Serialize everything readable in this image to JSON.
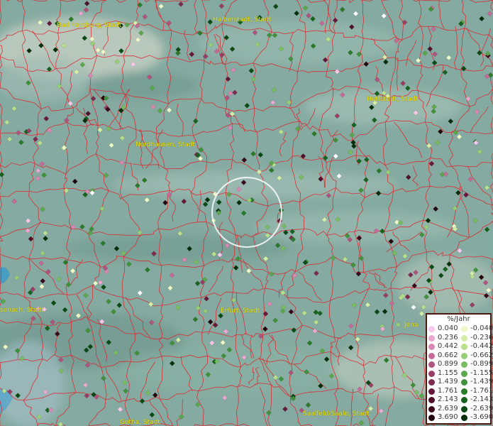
{
  "places": [
    {
      "name": "Bad Harzburg, Stadt"
    },
    {
      "name": "Halberstadt, Stadt"
    },
    {
      "name": "Hettstedt, Stadt"
    },
    {
      "name": "Nordhausen, Stadt"
    },
    {
      "name": "senach, Stadt"
    },
    {
      "name": "Erfurt, Stadt"
    },
    {
      "name": "Jena"
    },
    {
      "name": "Saalfeld/Saale, Stadt"
    },
    {
      "name": "Gotha, Stadt"
    }
  ],
  "legend": {
    "title": "%/Jahr",
    "positive": [
      "0.040",
      "0.236",
      "0.442",
      "0.662",
      "0.899",
      "1.155",
      "1.439",
      "1.761",
      "2.143",
      "2.639",
      "3.690"
    ],
    "negative": [
      "-0.040",
      "-0.236",
      "-0.442",
      "-0.662",
      "-0.899",
      "-1.155",
      "-1.439",
      "-1.761",
      "-2.143",
      "-2.639",
      "-3.690"
    ],
    "positive_colors": [
      "#f7c8ea",
      "#e9a8cf",
      "#d889b3",
      "#c56b97",
      "#b0537e",
      "#983e66",
      "#7f2a4f",
      "#67183a",
      "#501029",
      "#3a0a1b",
      "#23040d"
    ],
    "negative_colors": [
      "#eef8c6",
      "#d5eda6",
      "#b7df8c",
      "#97cf76",
      "#78bd60",
      "#5aa84b",
      "#3f9238",
      "#297b2a",
      "#17631e",
      "#0a4a14",
      "#03300b"
    ]
  },
  "colors": {
    "background": "#7fa9a0",
    "boundary": "#e0222a",
    "place_label": "#f3e300",
    "point_white": "#ffffff"
  }
}
